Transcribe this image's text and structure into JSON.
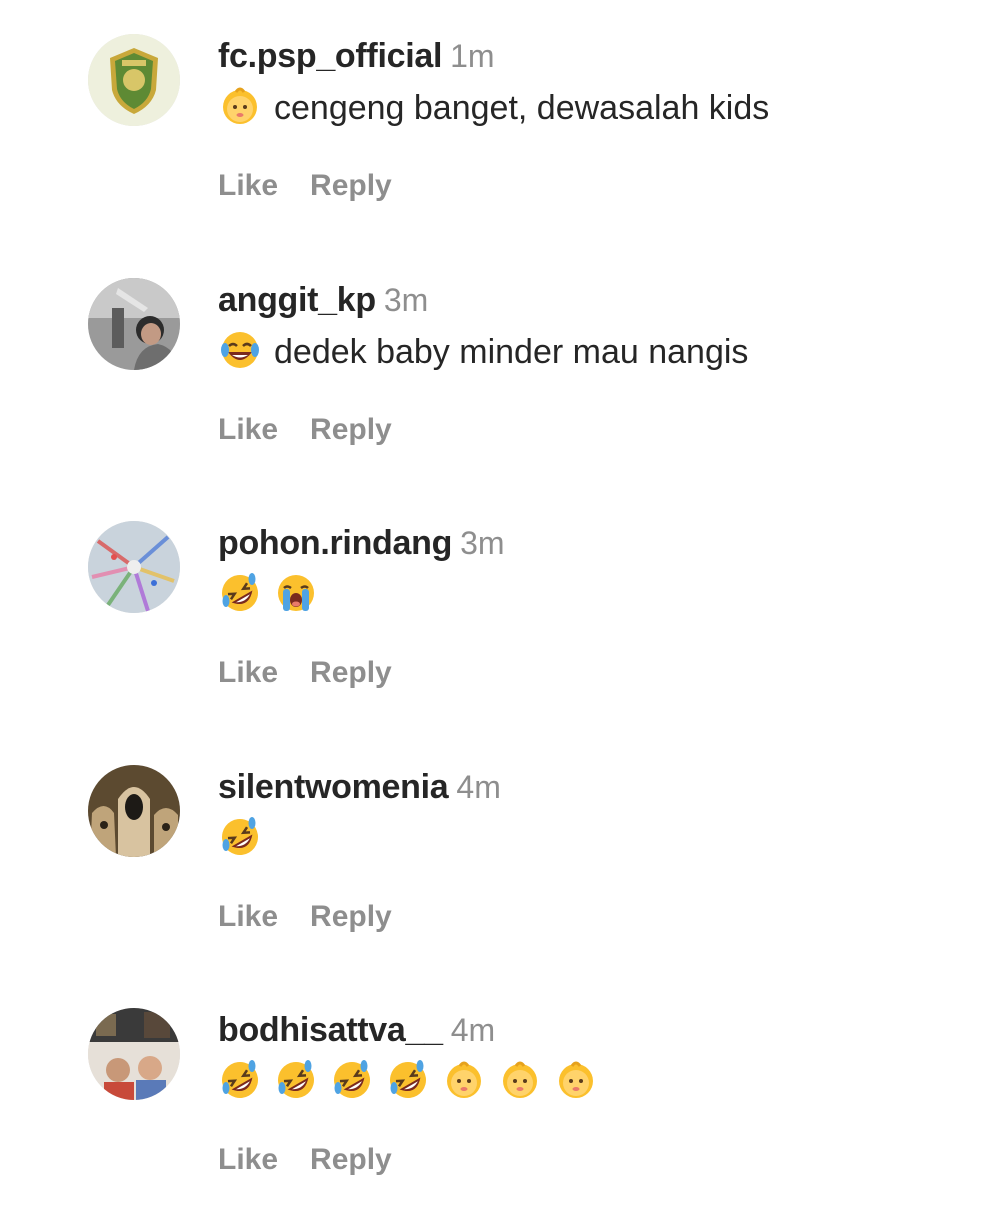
{
  "comments": [
    {
      "username": "fc.psp_official",
      "time": "1m",
      "emojis": [
        "baby-emoji"
      ],
      "text": "cengeng banget, dewasalah kids",
      "like_label": "Like",
      "reply_label": "Reply",
      "avatar": "club-crest-avatar"
    },
    {
      "username": "anggit_kp",
      "time": "3m",
      "emojis": [
        "tears-of-joy-emoji"
      ],
      "text": "dedek baby minder mau nangis",
      "like_label": "Like",
      "reply_label": "Reply",
      "avatar": "selfie-photo-avatar"
    },
    {
      "username": "pohon.rindang",
      "time": "3m",
      "emojis": [
        "rolling-laughing-emoji",
        "loudly-crying-emoji"
      ],
      "text": "",
      "like_label": "Like",
      "reply_label": "Reply",
      "avatar": "colorful-pattern-avatar"
    },
    {
      "username": "silentwomenia",
      "time": "4m",
      "emojis": [
        "rolling-laughing-emoji"
      ],
      "text": "",
      "like_label": "Like",
      "reply_label": "Reply",
      "avatar": "hooded-figures-avatar"
    },
    {
      "username": "bodhisattva__",
      "time": "4m",
      "emojis": [
        "rolling-laughing-emoji",
        "rolling-laughing-emoji",
        "rolling-laughing-emoji",
        "rolling-laughing-emoji",
        "baby-emoji",
        "baby-emoji",
        "baby-emoji"
      ],
      "text": "",
      "like_label": "Like",
      "reply_label": "Reply",
      "avatar": "group-photo-avatar"
    }
  ],
  "colors": {
    "username": "#262626",
    "text": "#262626",
    "meta": "#8e8e8e",
    "background": "#ffffff"
  }
}
